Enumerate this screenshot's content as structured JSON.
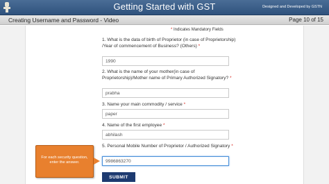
{
  "header": {
    "title": "Getting Started with GST",
    "credit": "Designed and Developed by GSTN"
  },
  "subheader": {
    "title": "Creating Username and Password - Video",
    "page_indicator": "Page 10 of 15"
  },
  "form": {
    "mandatory_note": "Indicates Mandatory Fields",
    "mandatory_marker": "*",
    "questions": [
      {
        "label": "1. What is the data of birth of Proprietor (in case of Proprietorship) /Year of commencement of Business? (Others)",
        "value": "1990"
      },
      {
        "label": "2. What is the name of your mother(in case of Proprietorship)/Mother name of Primary Authorized Signatory?",
        "value": "prabha"
      },
      {
        "label": "3. Name your main commodity / service",
        "value": "paper"
      },
      {
        "label": "4. Name of the first employee",
        "value": "abhilash"
      },
      {
        "label": "5. Personal Mobile Number of Proprietor / Authorized Signatory",
        "value": "9986863270"
      }
    ],
    "submit_label": "SUBMIT"
  },
  "callout": {
    "text": "For each security question, enter the answer."
  },
  "colors": {
    "header_bg": "#3b5f8a",
    "submit_bg": "#1d3a70",
    "callout_bg": "#e8802e",
    "required": "#d9251d"
  }
}
